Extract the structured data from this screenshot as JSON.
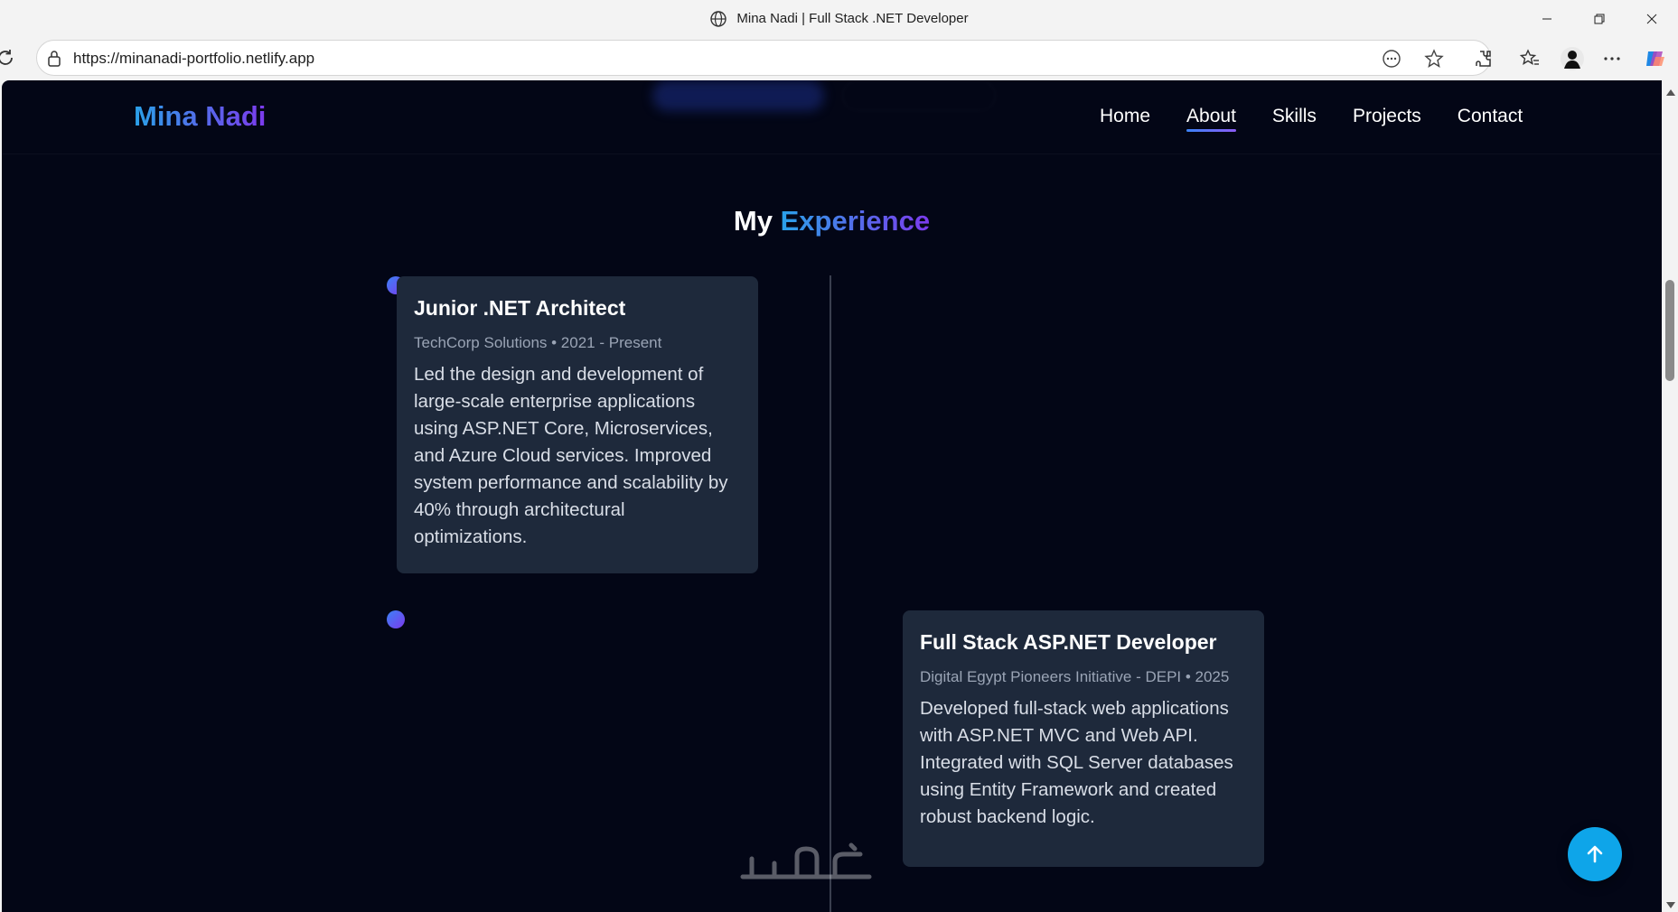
{
  "browser": {
    "tab_title": "Mina Nadi | Full Stack .NET Developer",
    "url": "https://minanadi-portfolio.netlify.app"
  },
  "site": {
    "brand": "Mina Nadi",
    "nav": [
      {
        "label": "Home",
        "active": false
      },
      {
        "label": "About",
        "active": true
      },
      {
        "label": "Skills",
        "active": false
      },
      {
        "label": "Projects",
        "active": false
      },
      {
        "label": "Contact",
        "active": false
      }
    ]
  },
  "experience": {
    "title_prefix": "My",
    "title_accent": "Experience",
    "items": [
      {
        "role": "Junior .NET Architect",
        "meta": "TechCorp Solutions • 2021 - Present",
        "description": "Led the design and development of large-scale enterprise applications using ASP.NET Core, Microservices, and Azure Cloud services. Improved system performance and scalability by 40% through architectural optimizations."
      },
      {
        "role": "Full Stack ASP.NET Developer",
        "meta": "Digital Egypt Pioneers Initiative - DEPI • 2025",
        "description": "Developed full-stack web applications with ASP.NET MVC and Web API. Integrated with SQL Server databases using Entity Framework and created robust backend logic."
      }
    ]
  },
  "watermark": "خمسات",
  "colors": {
    "page_bg": "#030616",
    "card_bg": "#1e293b",
    "accent_start": "#2aa1e8",
    "accent_end": "#7c3aed",
    "to_top_button": "#0ea5e9"
  },
  "icons": {
    "to_top": "arrow-up-icon"
  }
}
